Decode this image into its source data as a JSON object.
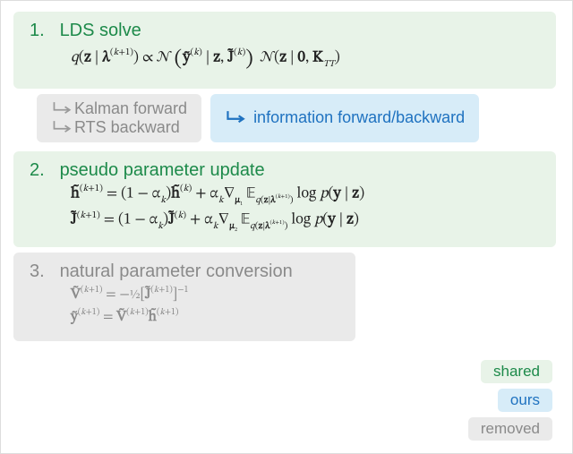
{
  "step1": {
    "num": "1.",
    "title": "LDS solve",
    "eq": "q(𝐳 | 𝛌^(k+1)) ∝ 𝒩( 𝐲̃^(k) | 𝐳, 𝐉̃^(k) )  𝒩(𝐳 | 𝟎, 𝐊_TT)"
  },
  "kalman": {
    "line1": "Kalman forward",
    "line2": "RTS backward"
  },
  "info": {
    "line1": "information forward/backward"
  },
  "step2": {
    "num": "2.",
    "title": "pseudo parameter update",
    "eq1": "𝐡̃^(k+1) = (1 − α_k) 𝐡̃^(k) + α_k ∇_𝛍₁ 𝔼_{q(𝐳|𝛌^(k+1))} log p(𝐲 | 𝐳)",
    "eq2": "𝐉̃^(k+1) = (1 − α_k) 𝐉̃^(k) + α_k ∇_𝛍₂ 𝔼_{q(𝐳|𝛌^(k+1))} log p(𝐲 | 𝐳)"
  },
  "step3": {
    "num": "3.",
    "title": "natural parameter conversion",
    "eq1": "𝐕̃^(k+1) = −½ [𝐉̃^(k+1)]⁻¹",
    "eq2": "𝐲̃^(k+1) = 𝐕̃^(k+1) 𝐡̃^(k+1)"
  },
  "legend": {
    "shared": "shared",
    "ours": "ours",
    "removed": "removed"
  }
}
